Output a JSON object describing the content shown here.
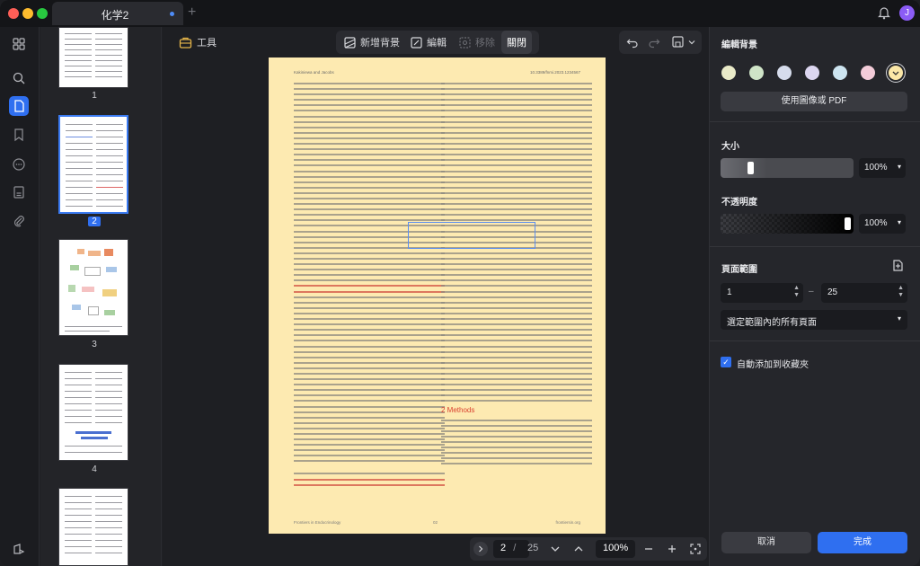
{
  "tabs": [
    {
      "label": "化学2"
    }
  ],
  "user": {
    "avatar_initial": "J"
  },
  "colors": {
    "accent": "#2f6ff0",
    "page_background": "#fdeab1",
    "swatches": [
      "#e9eac8",
      "#cfe4c7",
      "#d6dcec",
      "#dcd6f0",
      "#cde4f0",
      "#f3ccd9",
      "#fbe7a7"
    ],
    "selected_swatch_index": 6
  },
  "rail": {
    "icons": [
      "thumbnails-icon",
      "search-icon",
      "pages-icon",
      "bookmark-icon",
      "comment-icon",
      "form-icon",
      "attachment-icon",
      "layers-icon"
    ],
    "active_icon": "pages-icon"
  },
  "thumbnails": {
    "pages": [
      {
        "num": "1"
      },
      {
        "num": "2"
      },
      {
        "num": "3"
      },
      {
        "num": "4"
      },
      {
        "num": ""
      }
    ],
    "selected": "2"
  },
  "toolbar": {
    "tools_label": "工具",
    "add_background_label": "新增背景",
    "edit_label": "編輯",
    "remove_label": "移除",
    "close_label": "關閉"
  },
  "document": {
    "header_left": "Kakiniewa and Jacobs",
    "header_right": "10.3389/fnmi.2023.1234567",
    "section_heading": "2 Methods",
    "footer_left": "Frontiers in Endocrinology",
    "footer_center": "02",
    "footer_right": "frontiersin.org"
  },
  "navigation": {
    "current_page": "2",
    "separator": "/",
    "total_pages": "25",
    "zoom": "100%"
  },
  "panel": {
    "title": "編輯背景",
    "use_image_label": "使用圖像或 PDF",
    "size_label": "大小",
    "size_value": "100%",
    "size_slider_fraction": 0.2,
    "opacity_label": "不透明度",
    "opacity_value": "100%",
    "opacity_slider_fraction": 1.0,
    "page_range_label": "頁面範圍",
    "range_from": "1",
    "range_dash": "–",
    "range_to": "25",
    "range_mode": "選定範圍內的所有頁面",
    "auto_favorite_label": "自動添加到收藏夾",
    "auto_favorite_checked": true,
    "cancel_label": "取消",
    "done_label": "完成"
  }
}
